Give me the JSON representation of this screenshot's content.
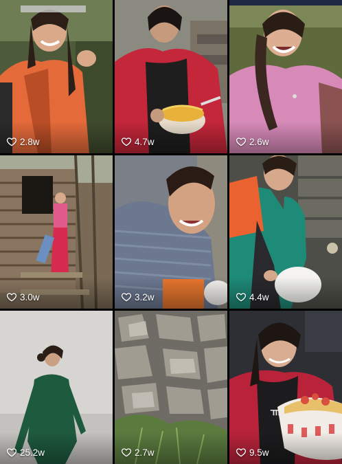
{
  "videos": [
    {
      "likes": "2.8w",
      "scene": "woman-orange-vest-outdoor"
    },
    {
      "likes": "4.7w",
      "scene": "woman-red-jacket-noodles"
    },
    {
      "likes": "2.6w",
      "scene": "woman-pink-top-braid"
    },
    {
      "likes": "3.0w",
      "scene": "woman-pink-by-cabin"
    },
    {
      "likes": "3.2w",
      "scene": "woman-grey-sweater-closeup"
    },
    {
      "likes": "4.4w",
      "scene": "woman-teal-jacket-bowl"
    },
    {
      "likes": "25.2w",
      "scene": "woman-green-coat-fog"
    },
    {
      "likes": "2.7w",
      "scene": "rocky-slope-plants"
    },
    {
      "likes": "9.5w",
      "scene": "woman-red-jacket-food-bowl"
    }
  ],
  "icons": {
    "like": "heart-outline-icon"
  }
}
